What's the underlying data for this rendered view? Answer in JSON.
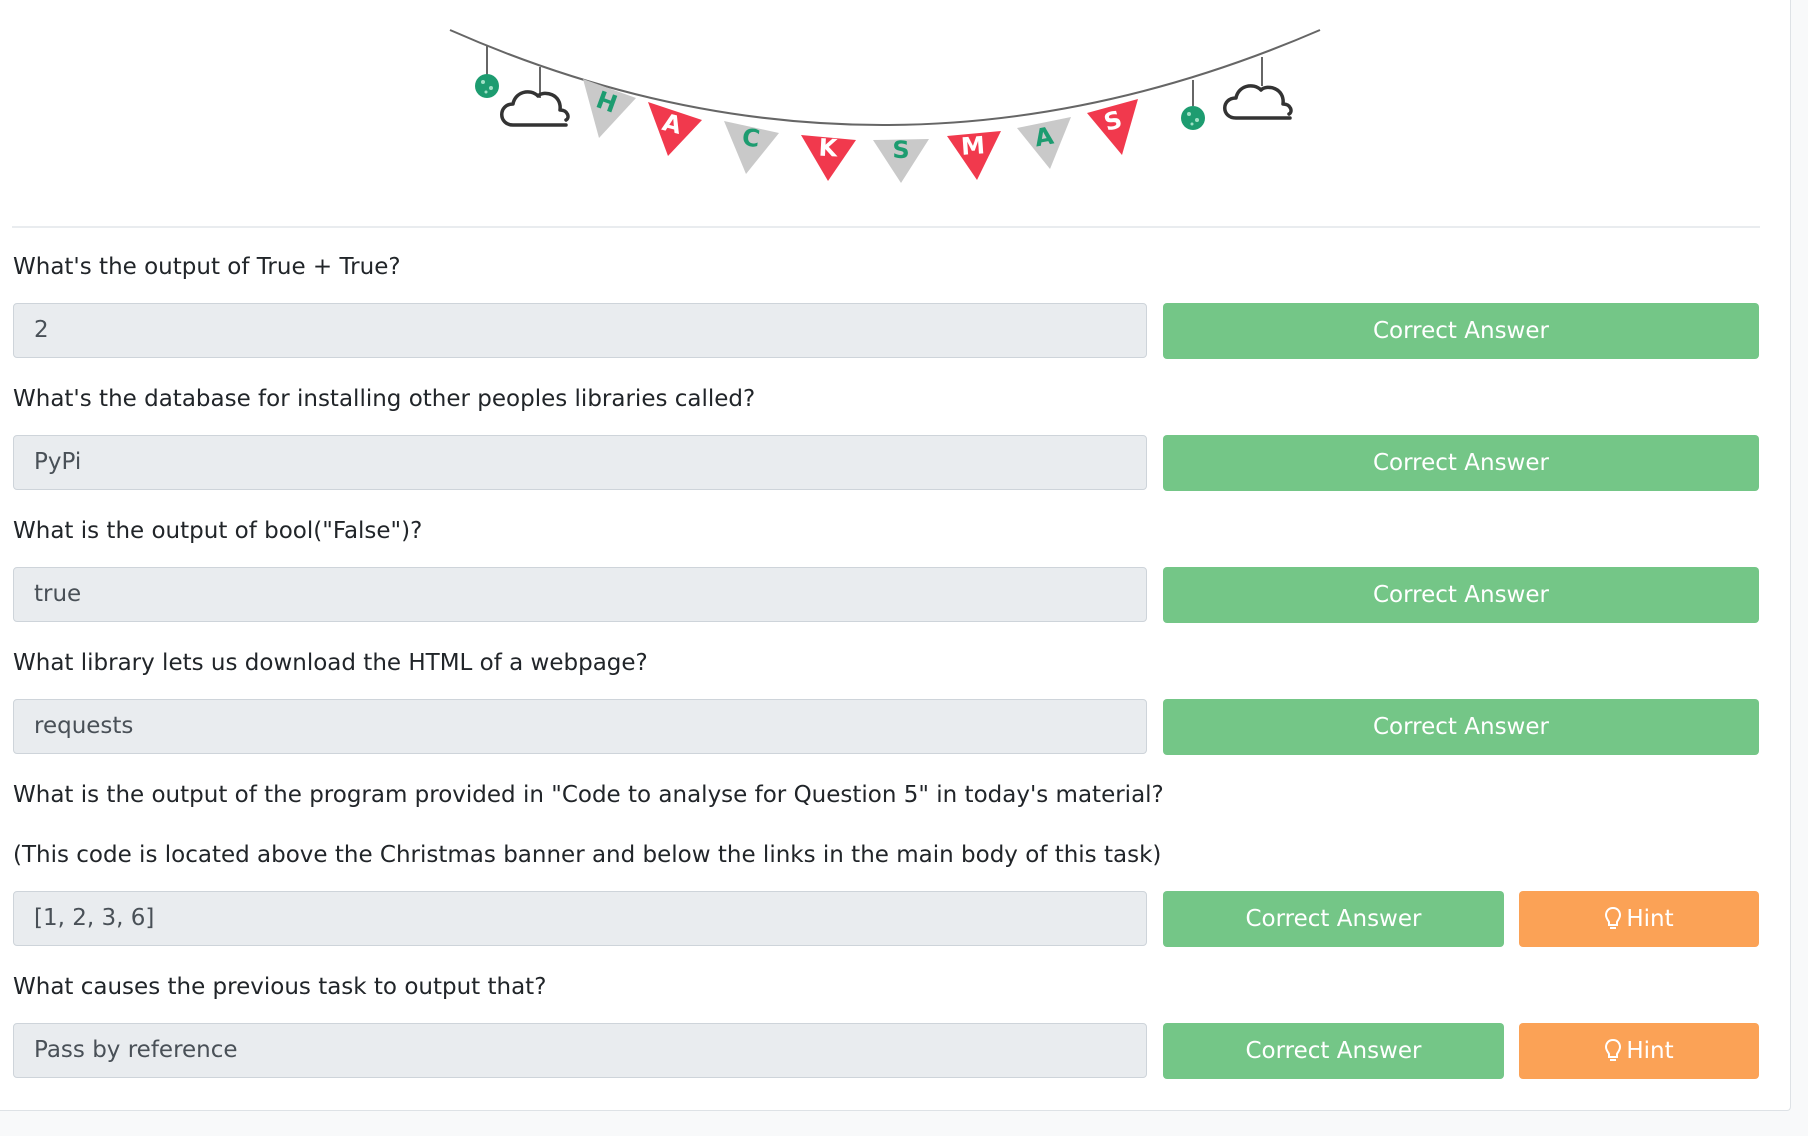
{
  "banner": {
    "letters": [
      "H",
      "A",
      "C",
      "K",
      "S",
      "M",
      "A",
      "S"
    ],
    "colors": {
      "red": "#f1394d",
      "grey": "#c9c9c9",
      "green": "#1d9c70",
      "rope": "#666666",
      "cloud": "#333333"
    },
    "icons": [
      "ornament-icon",
      "cloud-icon"
    ]
  },
  "quiz": [
    {
      "question": "What's the output of True + True?",
      "answer": "2",
      "button_label": "Correct Answer"
    },
    {
      "question": "What's the database for installing other peoples libraries called?",
      "answer": "PyPi",
      "button_label": "Correct Answer"
    },
    {
      "question": "What is the output of bool(\"False\")?",
      "answer": "true",
      "button_label": "Correct Answer"
    },
    {
      "question": "What library lets us download the HTML of a webpage?",
      "answer": "requests",
      "button_label": "Correct Answer"
    },
    {
      "question": "What is the output of the program provided in \"Code to analyse for Question 5\" in today's material?",
      "note": "(This code is located above the Christmas banner and below the links in the main body of this task)",
      "answer": "[1, 2, 3, 6]",
      "button_label": "Correct Answer",
      "hint_label": "Hint",
      "hint_icon": "lightbulb-icon"
    },
    {
      "question": "What causes the previous task to output that?",
      "answer": "Pass by reference",
      "button_label": "Correct Answer",
      "hint_label": "Hint",
      "hint_icon": "lightbulb-icon"
    }
  ],
  "colors": {
    "success": "#74c687",
    "warning": "#fba256",
    "input_bg": "#e9ecef"
  }
}
